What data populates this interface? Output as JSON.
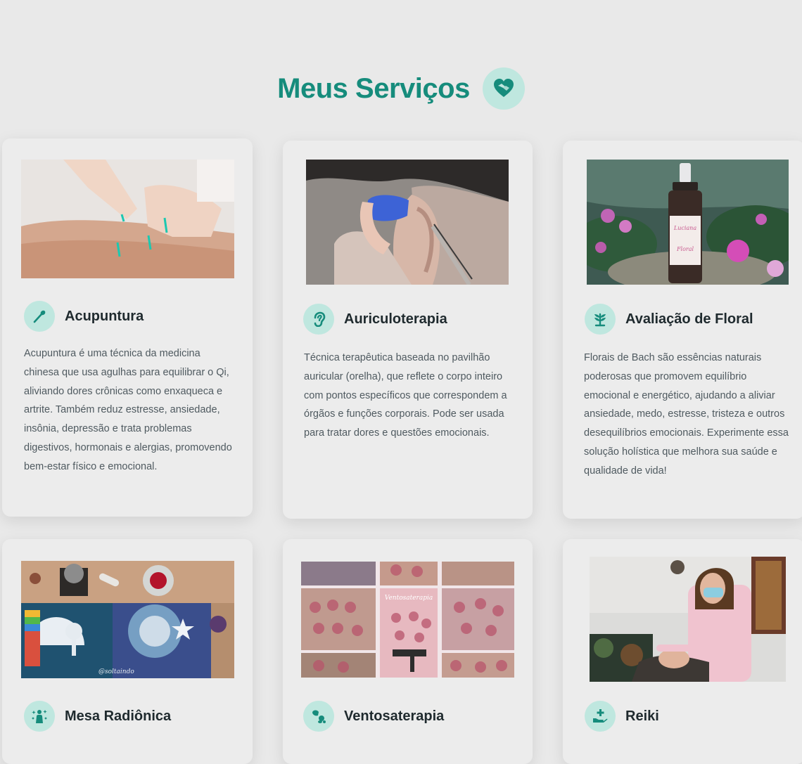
{
  "section": {
    "title": "Meus Serviços",
    "icon": "heart-handshake-icon"
  },
  "colors": {
    "accent": "#168c7c",
    "icon_bg": "#bfe7df",
    "card_bg": "#ececec",
    "page_bg": "#e9e9e9"
  },
  "services": [
    {
      "title": "Acupuntura",
      "icon": "acupuncture-needle-icon",
      "image": "acupuncture-photo",
      "description": "Acupuntura é uma técnica da medicina chinesa que usa agulhas para equilibrar o Qi, aliviando dores crônicas como enxaqueca e artrite. Também reduz estresse, ansiedade, insônia, depressão e trata problemas digestivos, hormonais e alergias, promovendo bem-estar físico e emocional."
    },
    {
      "title": "Auriculoterapia",
      "icon": "ear-icon",
      "image": "ear-therapy-photo",
      "description": "Técnica terapêutica baseada no pavilhão auricular (orelha), que reflete o corpo inteiro com pontos específicos que correspondem a órgãos e funções corporais. Pode ser usada para tratar dores e questões emocionais."
    },
    {
      "title": "Avaliação de Floral",
      "icon": "plant-icon",
      "image": "floral-bottle-photo",
      "description": "Florais de Bach são essências naturais poderosas que promovem equilíbrio emocional e energético, ajudando a aliviar ansiedade, medo, estresse, tristeza e outros desequilíbrios emocionais. Experimente essa solução holística que melhora sua saúde e qualidade de vida!"
    },
    {
      "title": "Mesa Radiônica",
      "icon": "person-sparkle-icon",
      "image": "radionic-table-photo",
      "image_text": "@soltaindo"
    },
    {
      "title": "Ventosaterapia",
      "icon": "cupping-icon",
      "image": "cupping-collage-photo",
      "image_text": "Ventosaterapia"
    },
    {
      "title": "Reiki",
      "icon": "hand-plus-icon",
      "image": "reiki-session-photo"
    }
  ]
}
